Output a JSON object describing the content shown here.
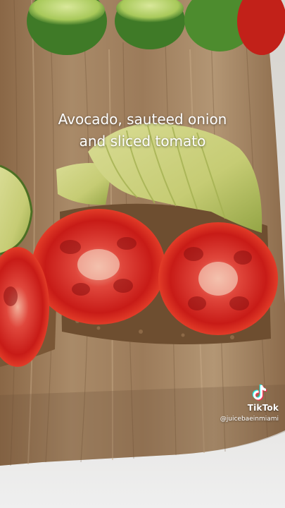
{
  "caption": {
    "line1": "Avocado, sauteed onion",
    "line2": "and sliced tomato"
  },
  "watermark": {
    "brand": "TikTok",
    "handle": "@juicebaeinmiami"
  },
  "scene": {
    "subjects": [
      "cutting-board",
      "limes",
      "avocado-slices",
      "tomato-slices",
      "toast"
    ]
  }
}
